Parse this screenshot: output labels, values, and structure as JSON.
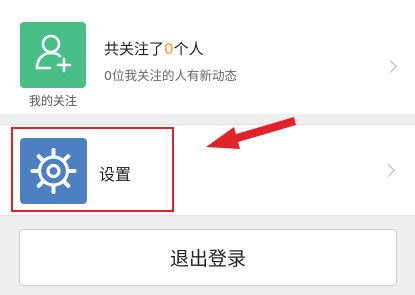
{
  "follow": {
    "title_prefix": "共关注了",
    "count": "0",
    "title_suffix": "个人",
    "subtitle": "0位我关注的人有新动态",
    "icon_label": "我的关注",
    "icon": "user-add-icon"
  },
  "settings": {
    "label": "设置",
    "icon": "gear-icon"
  },
  "logout": {
    "label": "退出登录"
  },
  "annotation": {
    "color": "#e0222a"
  },
  "colors": {
    "follow_tile": "#49bf87",
    "settings_tile": "#4d80c0",
    "accent": "#f39c32"
  }
}
